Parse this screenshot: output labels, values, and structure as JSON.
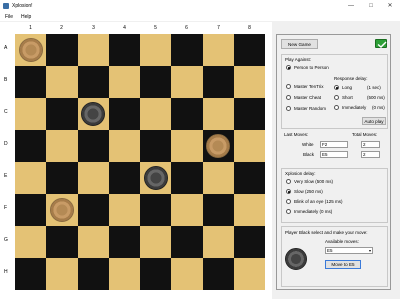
{
  "window": {
    "title": "Xplosion!",
    "minimize": "—",
    "maximize": "□",
    "close": "✕"
  },
  "menu": {
    "file": "File",
    "help": "Help"
  },
  "board": {
    "columns": [
      "1",
      "2",
      "3",
      "4",
      "5",
      "6",
      "7",
      "8"
    ],
    "rows": [
      "A",
      "B",
      "C",
      "D",
      "E",
      "F",
      "G",
      "H"
    ],
    "colors": {
      "light": "#e4c275",
      "dark": "#111111"
    }
  },
  "panel": {
    "new_game": "New Game",
    "play_against": "Play Against:",
    "person_to_person": "Person to Person",
    "master_tentrix": "Master TenTrix",
    "master_cheat": "Master Cheat",
    "master_random": "Master Random",
    "response_delay": "Response delay:",
    "long": "Long",
    "long_time": "(1 sec)",
    "short": "Short",
    "short_time": "(500 ms)",
    "immediately": "Immediately",
    "immediately_time": "(0 ms)",
    "auto_play": "Auto play",
    "last_moves": "Last Moves:",
    "total_moves": "Total Moves:",
    "white_label": "White",
    "black_label": "Black",
    "white_last": "F2",
    "black_last": "E5",
    "white_total": "2",
    "black_total": "2",
    "xplosion_delay": "Xplosion delay:",
    "very_slow": "Very Slow (500 ms)",
    "slow": "Slow (250 ms)",
    "blink": "Blink of an eye (125 ms)",
    "immediately_x": "Immediately (0 ms)",
    "status": "Player Black select and make your move:",
    "available_moves": "Available moves:",
    "selected_move": "E5",
    "move_button": "Move to E5"
  }
}
